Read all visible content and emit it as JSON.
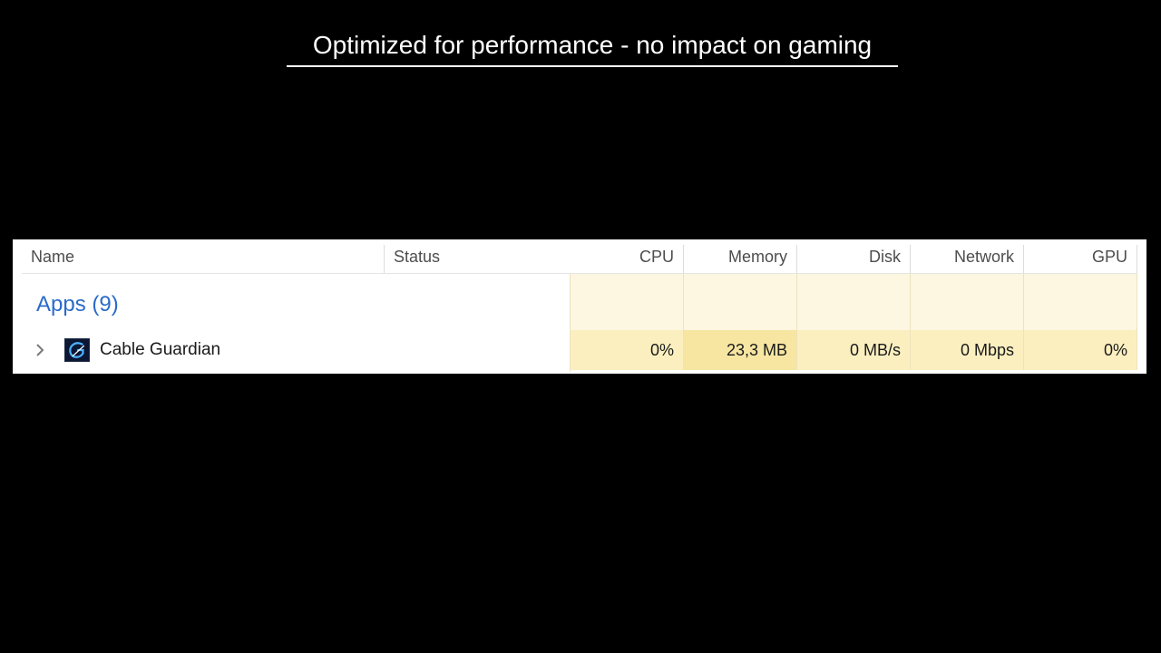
{
  "slide": {
    "title": "Optimized for performance - no impact on gaming"
  },
  "task_manager": {
    "columns": {
      "name": "Name",
      "status": "Status",
      "cpu": "CPU",
      "memory": "Memory",
      "disk": "Disk",
      "network": "Network",
      "gpu": "GPU"
    },
    "group": {
      "label": "Apps (9)"
    },
    "process": {
      "name": "Cable Guardian",
      "icon": "cable-guardian-app-icon",
      "cpu": "0%",
      "memory": "23,3 MB",
      "disk": "0 MB/s",
      "network": "0 Mbps",
      "gpu": "0%"
    }
  },
  "colors": {
    "background": "#000000",
    "heat_light": "#fdf6e0",
    "heat_medium": "#fbefc0",
    "heat_strong": "#f7e6a2",
    "group_label": "#2a6bc9"
  }
}
